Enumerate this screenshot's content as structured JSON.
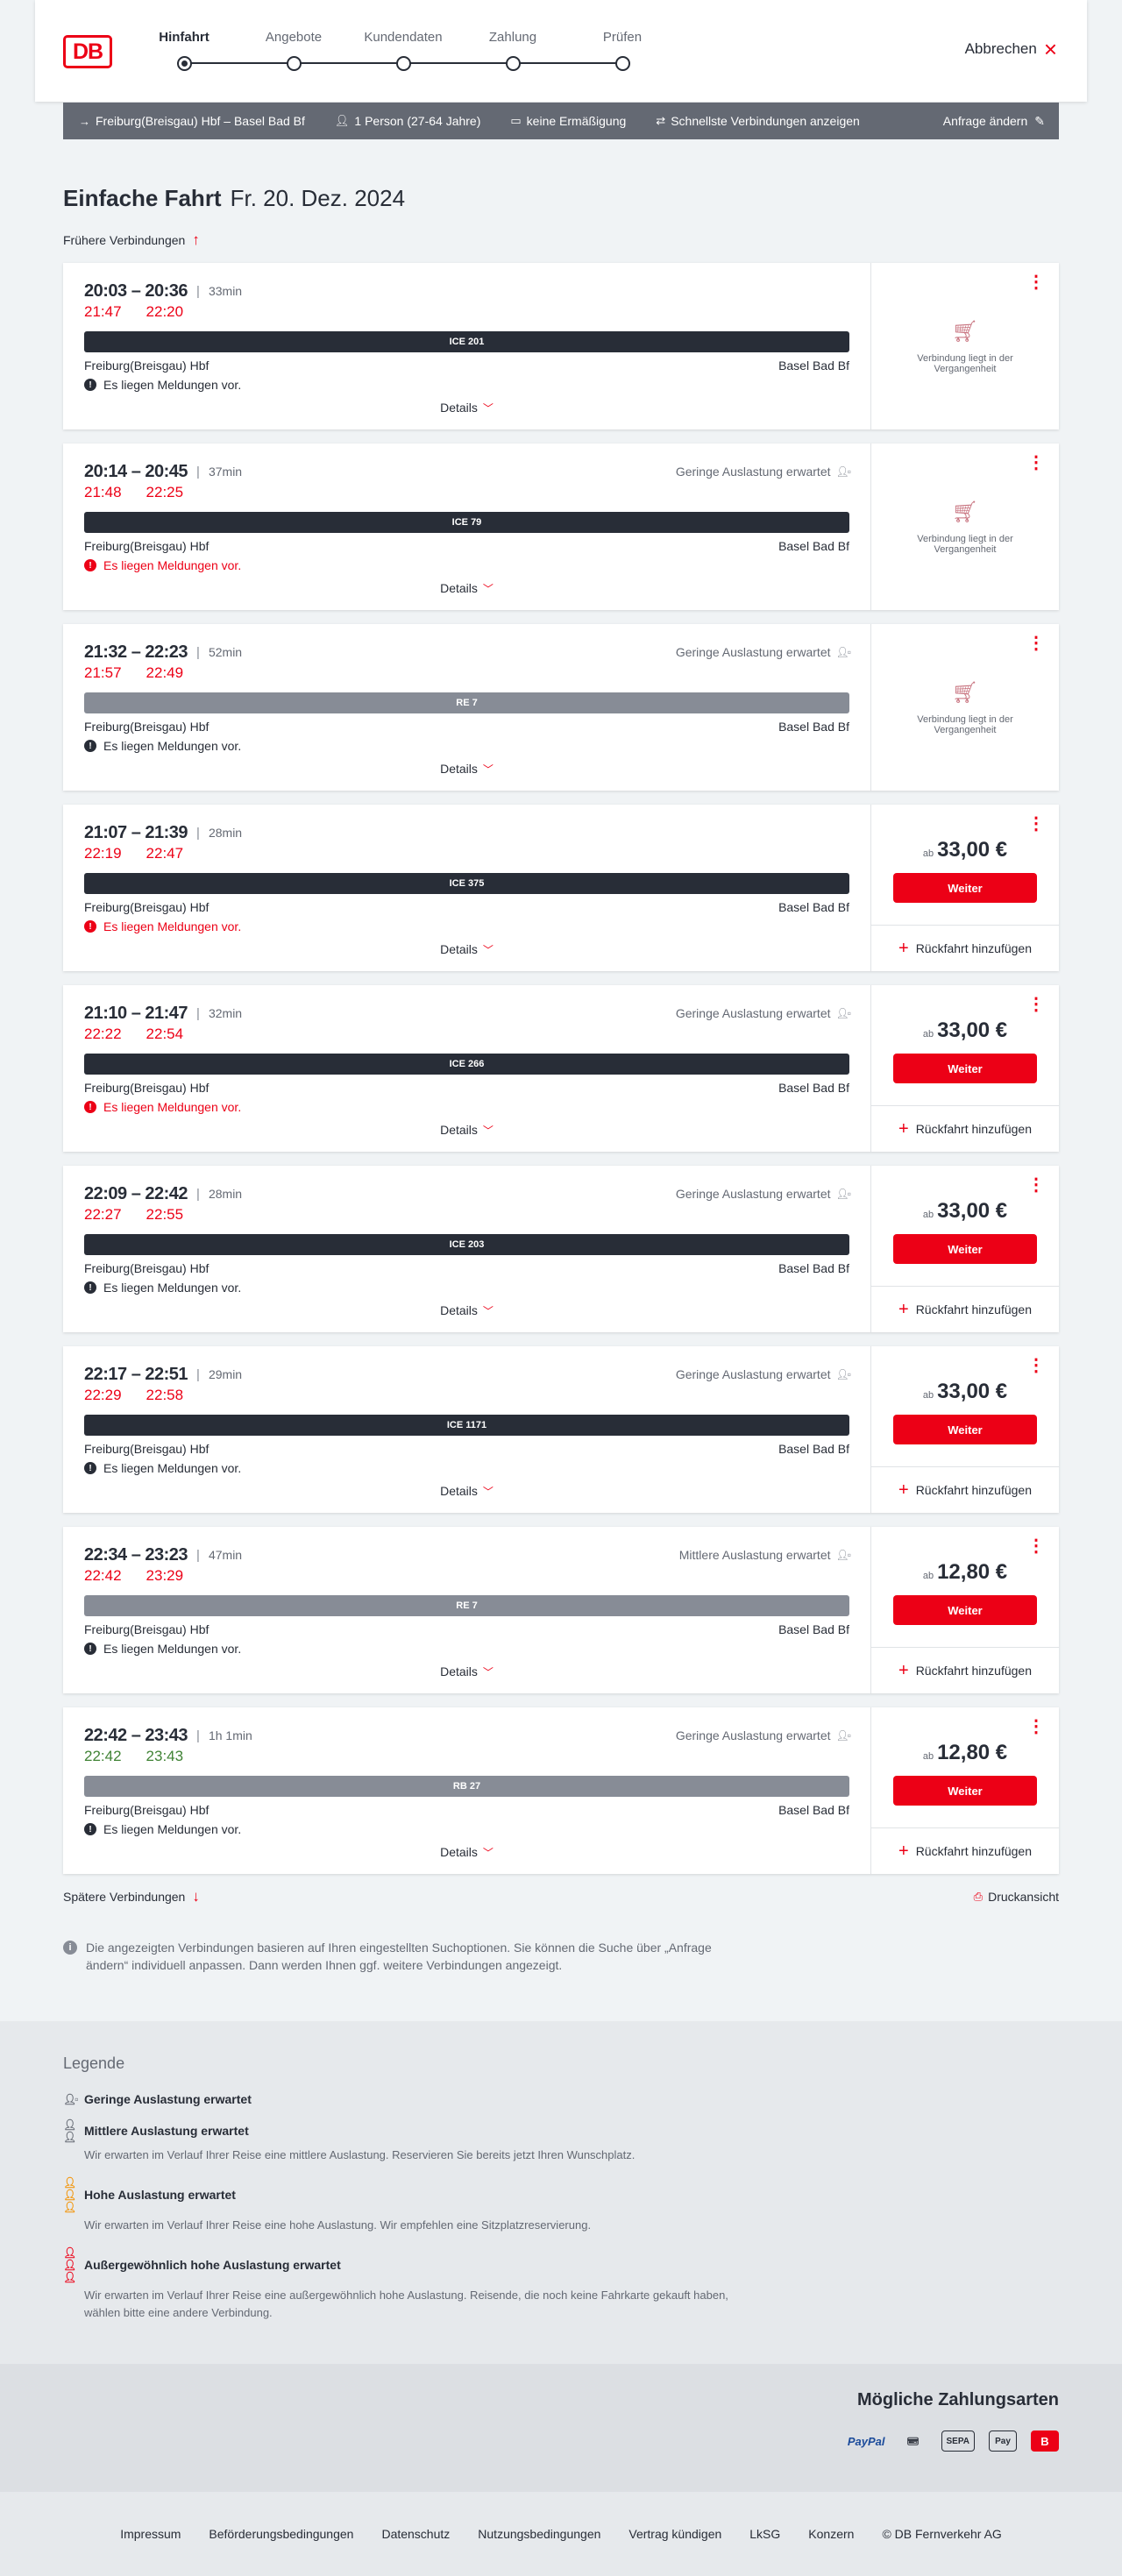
{
  "header": {
    "logo": "DB",
    "steps": [
      "Hinfahrt",
      "Angebote",
      "Kundendaten",
      "Zahlung",
      "Prüfen"
    ],
    "cancel": "Abbrechen"
  },
  "query": {
    "route": "Freiburg(Breisgau) Hbf – Basel Bad Bf",
    "passengers": "1 Person (27-64 Jahre)",
    "discount": "keine Ermäßigung",
    "fastest": "Schnellste Verbindungen anzeigen",
    "change": "Anfrage ändern"
  },
  "title": {
    "trip_type": "Einfache Fahrt",
    "date": "Fr. 20. Dez. 2024"
  },
  "earlier": "Frühere Verbindungen",
  "details_label": "Details",
  "past_text": "Verbindung liegt in der Vergangenheit",
  "price_from": "ab",
  "weiter": "Weiter",
  "return_label": "Rückfahrt hinzufügen",
  "connections": [
    {
      "times": "20:03 – 20:36",
      "duration": "33min",
      "occupancy": "",
      "rt_dep": "21:47",
      "rt_arr": "22:20",
      "rt_color": "late",
      "train": "ICE 201",
      "bar": "dark",
      "from": "Freiburg(Breisgau) Hbf",
      "to": "Basel Bad Bf",
      "notice": "Es liegen Meldungen vor.",
      "notice_type": "info",
      "past": true,
      "price": ""
    },
    {
      "times": "20:14 – 20:45",
      "duration": "37min",
      "occupancy": "Geringe Auslastung erwartet",
      "rt_dep": "21:48",
      "rt_arr": "22:25",
      "rt_color": "late",
      "train": "ICE 79",
      "bar": "dark",
      "from": "Freiburg(Breisgau) Hbf",
      "to": "Basel Bad Bf",
      "notice": "Es liegen Meldungen vor.",
      "notice_type": "warn",
      "past": true,
      "price": ""
    },
    {
      "times": "21:32 – 22:23",
      "duration": "52min",
      "occupancy": "Geringe Auslastung erwartet",
      "rt_dep": "21:57",
      "rt_arr": "22:49",
      "rt_color": "late",
      "train": "RE 7",
      "bar": "grey",
      "from": "Freiburg(Breisgau) Hbf",
      "to": "Basel Bad Bf",
      "notice": "Es liegen Meldungen vor.",
      "notice_type": "info",
      "past": true,
      "price": ""
    },
    {
      "times": "21:07 – 21:39",
      "duration": "28min",
      "occupancy": "",
      "rt_dep": "22:19",
      "rt_arr": "22:47",
      "rt_color": "late",
      "train": "ICE 375",
      "bar": "dark",
      "from": "Freiburg(Breisgau) Hbf",
      "to": "Basel Bad Bf",
      "notice": "Es liegen Meldungen vor.",
      "notice_type": "warn",
      "past": false,
      "price": "33,00 €"
    },
    {
      "times": "21:10 – 21:47",
      "duration": "32min",
      "occupancy": "Geringe Auslastung erwartet",
      "rt_dep": "22:22",
      "rt_arr": "22:54",
      "rt_color": "late",
      "train": "ICE 266",
      "bar": "dark",
      "from": "Freiburg(Breisgau) Hbf",
      "to": "Basel Bad Bf",
      "notice": "Es liegen Meldungen vor.",
      "notice_type": "warn",
      "past": false,
      "price": "33,00 €"
    },
    {
      "times": "22:09 – 22:42",
      "duration": "28min",
      "occupancy": "Geringe Auslastung erwartet",
      "rt_dep": "22:27",
      "rt_arr": "22:55",
      "rt_color": "late",
      "train": "ICE 203",
      "bar": "dark",
      "from": "Freiburg(Breisgau) Hbf",
      "to": "Basel Bad Bf",
      "notice": "Es liegen Meldungen vor.",
      "notice_type": "info",
      "past": false,
      "price": "33,00 €"
    },
    {
      "times": "22:17 – 22:51",
      "duration": "29min",
      "occupancy": "Geringe Auslastung erwartet",
      "rt_dep": "22:29",
      "rt_arr": "22:58",
      "rt_color": "late",
      "train": "ICE 1171",
      "bar": "dark",
      "from": "Freiburg(Breisgau) Hbf",
      "to": "Basel Bad Bf",
      "notice": "Es liegen Meldungen vor.",
      "notice_type": "info",
      "past": false,
      "price": "33,00 €"
    },
    {
      "times": "22:34 – 23:23",
      "duration": "47min",
      "occupancy": "Mittlere Auslastung erwartet",
      "rt_dep": "22:42",
      "rt_arr": "23:29",
      "rt_color": "late",
      "train": "RE 7",
      "bar": "grey",
      "from": "Freiburg(Breisgau) Hbf",
      "to": "Basel Bad Bf",
      "notice": "Es liegen Meldungen vor.",
      "notice_type": "info",
      "past": false,
      "price": "12,80 €"
    },
    {
      "times": "22:42 – 23:43",
      "duration": "1h 1min",
      "occupancy": "Geringe Auslastung erwartet",
      "rt_dep": "22:42",
      "rt_arr": "23:43",
      "rt_color": "ok",
      "train": "RB 27",
      "bar": "grey",
      "from": "Freiburg(Breisgau) Hbf",
      "to": "Basel Bad Bf",
      "notice": "Es liegen Meldungen vor.",
      "notice_type": "info",
      "past": false,
      "price": "12,80 €"
    }
  ],
  "later": "Spätere Verbindungen",
  "print": "Druckansicht",
  "info_note": "Die angezeigten Verbindungen basieren auf Ihren eingestellten Suchoptionen. Sie können die Suche über „Anfrage ändern“ individuell anpassen. Dann werden Ihnen ggf. weitere Verbindungen angezeigt.",
  "legend": {
    "title": "Legende",
    "items": [
      {
        "head": "Geringe Auslastung erwartet",
        "desc": "",
        "color": "#646973"
      },
      {
        "head": "Mittlere Auslastung erwartet",
        "desc": "Wir erwarten im Verlauf Ihrer Reise eine mittlere Auslastung. Reservieren Sie bereits jetzt Ihren Wunschplatz.",
        "color": "#646973"
      },
      {
        "head": "Hohe Auslastung erwartet",
        "desc": "Wir erwarten im Verlauf Ihrer Reise eine hohe Auslastung. Wir empfehlen eine Sitzplatzreservierung.",
        "color": "#f39200"
      },
      {
        "head": "Außergewöhnlich hohe Auslastung erwartet",
        "desc": "Wir erwarten im Verlauf Ihrer Reise eine außergewöhnlich hohe Auslastung. Reisende, die noch keine Fahrkarte gekauft haben, wählen bitte eine andere Verbindung.",
        "color": "#ec0016"
      }
    ]
  },
  "payment": {
    "title": "Mögliche Zahlungsarten",
    "methods": [
      "PayPal",
      "Kreditkarte",
      "SEPA",
      "Apple Pay",
      "DB"
    ]
  },
  "footer": [
    "Impressum",
    "Beförderungsbedingungen",
    "Datenschutz",
    "Nutzungsbedingungen",
    "Vertrag kündigen",
    "LkSG",
    "Konzern",
    "© DB Fernverkehr AG"
  ],
  "colors": {
    "brand_red": "#ec0016",
    "on_time_green": "#408335",
    "dark": "#282d37",
    "grey": "#878c96"
  }
}
